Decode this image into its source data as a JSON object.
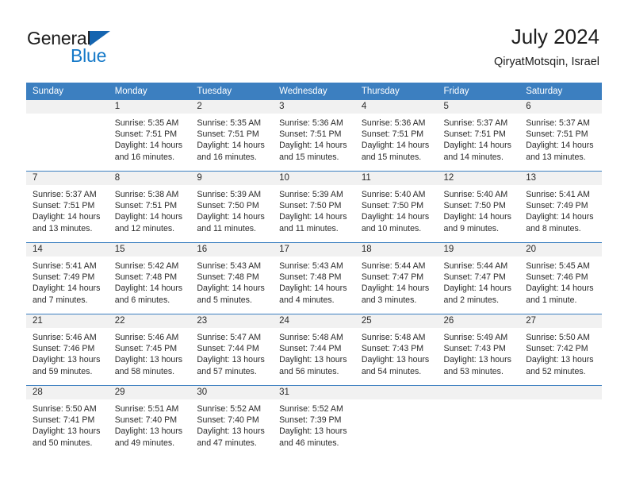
{
  "brand": {
    "line1": "General",
    "line2": "Blue",
    "triangle_color": "#1565b0",
    "blue_text_color": "#1579c8"
  },
  "header": {
    "title": "July 2024",
    "subtitle": "QiryatMotsqin, Israel"
  },
  "theme": {
    "header_blue": "#3c7fc0",
    "daynum_band": "#f1f1f1",
    "text": "#2a2a2a"
  },
  "weekday_headers": [
    "Sunday",
    "Monday",
    "Tuesday",
    "Wednesday",
    "Thursday",
    "Friday",
    "Saturday"
  ],
  "labels": {
    "sunrise_prefix": "Sunrise:",
    "sunset_prefix": "Sunset:",
    "daylight_prefix": "Daylight:"
  },
  "weeks": [
    [
      {
        "day": "",
        "empty": true
      },
      {
        "day": "1",
        "sunrise": "Sunrise: 5:35 AM",
        "sunset": "Sunset: 7:51 PM",
        "daylight1": "Daylight: 14 hours",
        "daylight2": "and 16 minutes."
      },
      {
        "day": "2",
        "sunrise": "Sunrise: 5:35 AM",
        "sunset": "Sunset: 7:51 PM",
        "daylight1": "Daylight: 14 hours",
        "daylight2": "and 16 minutes."
      },
      {
        "day": "3",
        "sunrise": "Sunrise: 5:36 AM",
        "sunset": "Sunset: 7:51 PM",
        "daylight1": "Daylight: 14 hours",
        "daylight2": "and 15 minutes."
      },
      {
        "day": "4",
        "sunrise": "Sunrise: 5:36 AM",
        "sunset": "Sunset: 7:51 PM",
        "daylight1": "Daylight: 14 hours",
        "daylight2": "and 15 minutes."
      },
      {
        "day": "5",
        "sunrise": "Sunrise: 5:37 AM",
        "sunset": "Sunset: 7:51 PM",
        "daylight1": "Daylight: 14 hours",
        "daylight2": "and 14 minutes."
      },
      {
        "day": "6",
        "sunrise": "Sunrise: 5:37 AM",
        "sunset": "Sunset: 7:51 PM",
        "daylight1": "Daylight: 14 hours",
        "daylight2": "and 13 minutes."
      }
    ],
    [
      {
        "day": "7",
        "sunrise": "Sunrise: 5:37 AM",
        "sunset": "Sunset: 7:51 PM",
        "daylight1": "Daylight: 14 hours",
        "daylight2": "and 13 minutes."
      },
      {
        "day": "8",
        "sunrise": "Sunrise: 5:38 AM",
        "sunset": "Sunset: 7:51 PM",
        "daylight1": "Daylight: 14 hours",
        "daylight2": "and 12 minutes."
      },
      {
        "day": "9",
        "sunrise": "Sunrise: 5:39 AM",
        "sunset": "Sunset: 7:50 PM",
        "daylight1": "Daylight: 14 hours",
        "daylight2": "and 11 minutes."
      },
      {
        "day": "10",
        "sunrise": "Sunrise: 5:39 AM",
        "sunset": "Sunset: 7:50 PM",
        "daylight1": "Daylight: 14 hours",
        "daylight2": "and 11 minutes."
      },
      {
        "day": "11",
        "sunrise": "Sunrise: 5:40 AM",
        "sunset": "Sunset: 7:50 PM",
        "daylight1": "Daylight: 14 hours",
        "daylight2": "and 10 minutes."
      },
      {
        "day": "12",
        "sunrise": "Sunrise: 5:40 AM",
        "sunset": "Sunset: 7:50 PM",
        "daylight1": "Daylight: 14 hours",
        "daylight2": "and 9 minutes."
      },
      {
        "day": "13",
        "sunrise": "Sunrise: 5:41 AM",
        "sunset": "Sunset: 7:49 PM",
        "daylight1": "Daylight: 14 hours",
        "daylight2": "and 8 minutes."
      }
    ],
    [
      {
        "day": "14",
        "sunrise": "Sunrise: 5:41 AM",
        "sunset": "Sunset: 7:49 PM",
        "daylight1": "Daylight: 14 hours",
        "daylight2": "and 7 minutes."
      },
      {
        "day": "15",
        "sunrise": "Sunrise: 5:42 AM",
        "sunset": "Sunset: 7:48 PM",
        "daylight1": "Daylight: 14 hours",
        "daylight2": "and 6 minutes."
      },
      {
        "day": "16",
        "sunrise": "Sunrise: 5:43 AM",
        "sunset": "Sunset: 7:48 PM",
        "daylight1": "Daylight: 14 hours",
        "daylight2": "and 5 minutes."
      },
      {
        "day": "17",
        "sunrise": "Sunrise: 5:43 AM",
        "sunset": "Sunset: 7:48 PM",
        "daylight1": "Daylight: 14 hours",
        "daylight2": "and 4 minutes."
      },
      {
        "day": "18",
        "sunrise": "Sunrise: 5:44 AM",
        "sunset": "Sunset: 7:47 PM",
        "daylight1": "Daylight: 14 hours",
        "daylight2": "and 3 minutes."
      },
      {
        "day": "19",
        "sunrise": "Sunrise: 5:44 AM",
        "sunset": "Sunset: 7:47 PM",
        "daylight1": "Daylight: 14 hours",
        "daylight2": "and 2 minutes."
      },
      {
        "day": "20",
        "sunrise": "Sunrise: 5:45 AM",
        "sunset": "Sunset: 7:46 PM",
        "daylight1": "Daylight: 14 hours",
        "daylight2": "and 1 minute."
      }
    ],
    [
      {
        "day": "21",
        "sunrise": "Sunrise: 5:46 AM",
        "sunset": "Sunset: 7:46 PM",
        "daylight1": "Daylight: 13 hours",
        "daylight2": "and 59 minutes."
      },
      {
        "day": "22",
        "sunrise": "Sunrise: 5:46 AM",
        "sunset": "Sunset: 7:45 PM",
        "daylight1": "Daylight: 13 hours",
        "daylight2": "and 58 minutes."
      },
      {
        "day": "23",
        "sunrise": "Sunrise: 5:47 AM",
        "sunset": "Sunset: 7:44 PM",
        "daylight1": "Daylight: 13 hours",
        "daylight2": "and 57 minutes."
      },
      {
        "day": "24",
        "sunrise": "Sunrise: 5:48 AM",
        "sunset": "Sunset: 7:44 PM",
        "daylight1": "Daylight: 13 hours",
        "daylight2": "and 56 minutes."
      },
      {
        "day": "25",
        "sunrise": "Sunrise: 5:48 AM",
        "sunset": "Sunset: 7:43 PM",
        "daylight1": "Daylight: 13 hours",
        "daylight2": "and 54 minutes."
      },
      {
        "day": "26",
        "sunrise": "Sunrise: 5:49 AM",
        "sunset": "Sunset: 7:43 PM",
        "daylight1": "Daylight: 13 hours",
        "daylight2": "and 53 minutes."
      },
      {
        "day": "27",
        "sunrise": "Sunrise: 5:50 AM",
        "sunset": "Sunset: 7:42 PM",
        "daylight1": "Daylight: 13 hours",
        "daylight2": "and 52 minutes."
      }
    ],
    [
      {
        "day": "28",
        "sunrise": "Sunrise: 5:50 AM",
        "sunset": "Sunset: 7:41 PM",
        "daylight1": "Daylight: 13 hours",
        "daylight2": "and 50 minutes."
      },
      {
        "day": "29",
        "sunrise": "Sunrise: 5:51 AM",
        "sunset": "Sunset: 7:40 PM",
        "daylight1": "Daylight: 13 hours",
        "daylight2": "and 49 minutes."
      },
      {
        "day": "30",
        "sunrise": "Sunrise: 5:52 AM",
        "sunset": "Sunset: 7:40 PM",
        "daylight1": "Daylight: 13 hours",
        "daylight2": "and 47 minutes."
      },
      {
        "day": "31",
        "sunrise": "Sunrise: 5:52 AM",
        "sunset": "Sunset: 7:39 PM",
        "daylight1": "Daylight: 13 hours",
        "daylight2": "and 46 minutes."
      },
      {
        "day": "",
        "empty": true
      },
      {
        "day": "",
        "empty": true
      },
      {
        "day": "",
        "empty": true
      }
    ]
  ]
}
